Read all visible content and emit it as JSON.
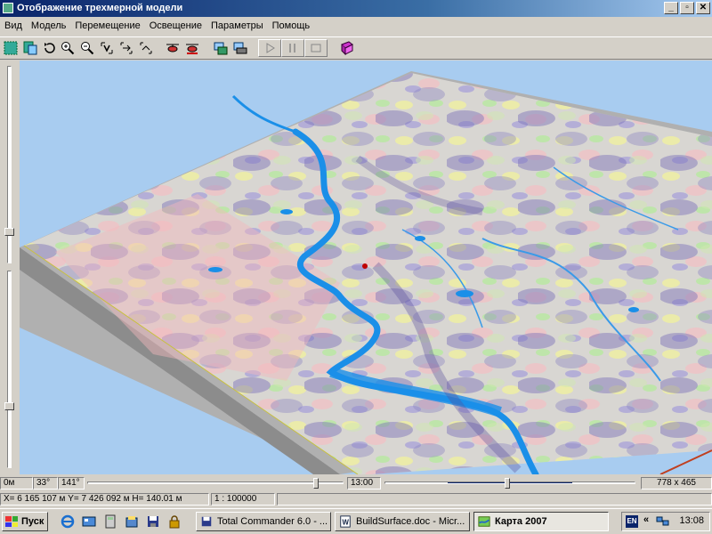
{
  "window": {
    "title": "Отображение трехмерной модели"
  },
  "window_buttons": {
    "minimize": "_",
    "maximize": "▫",
    "close": "✕"
  },
  "menu": [
    "Вид",
    "Модель",
    "Перемещение",
    "Освещение",
    "Параметры",
    "Помощь"
  ],
  "toolbar": {
    "icons": [
      "select-icon",
      "select-layers-icon",
      "rotate-icon",
      "zoom-in-icon",
      "zoom-out-icon",
      "fit-icon",
      "shift-icon",
      "reset-view-icon",
      "helicopter-icon",
      "flight-icon",
      "export-icon",
      "print-icon",
      "play-icon",
      "pause-icon",
      "stop-icon",
      "help-book-icon"
    ]
  },
  "status_row1": {
    "height": "0м",
    "angle1": "33°",
    "angle2": "141°",
    "elevation_slider_value": 0.9,
    "time": "13:00",
    "time_slider_value": 0.48,
    "dims": "778 x 465"
  },
  "status_row2": {
    "coords": "X= 6 165 107 м  Y= 7 426 092 м  H= 140.01 м",
    "scale": "1 : 100000"
  },
  "left_slider": {
    "upper_value": 0.95,
    "lower_value": 0.28
  },
  "taskbar": {
    "start_label": "Пуск",
    "quicklaunch": [
      "ie-icon",
      "desktop-icon",
      "calc-icon",
      "explorer-icon",
      "floppy-icon",
      "lock-icon"
    ],
    "tasks": [
      {
        "label": "Total Commander 6.0 - ...",
        "icon": "floppy-icon"
      },
      {
        "label": "BuildSurface.doc - Micr...",
        "icon": "word-icon"
      },
      {
        "label": "Карта 2007",
        "icon": "map-icon",
        "active": true
      }
    ],
    "tray": {
      "lang": "EN",
      "time": "13:08"
    }
  },
  "colors": {
    "sky": "#a8ccf0",
    "river": "#1a8fe8",
    "terrain_base": "#d8d6d2",
    "titlebar": "#0a246a"
  }
}
